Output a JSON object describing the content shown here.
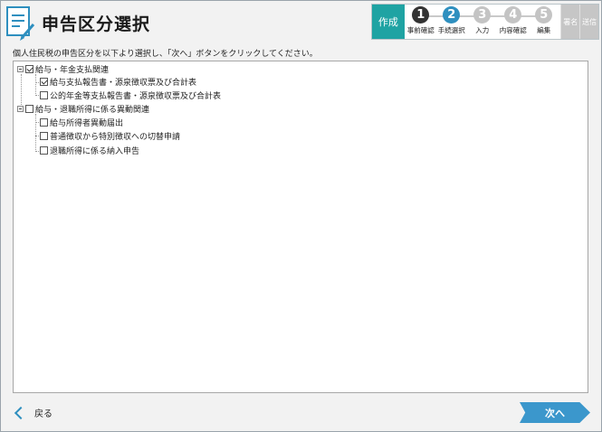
{
  "header": {
    "title": "申告区分選択",
    "icon": "document-pen-icon"
  },
  "stepbar": {
    "current_label": "作成",
    "steps": [
      {
        "num": "1",
        "label": "事前確認",
        "state": "done"
      },
      {
        "num": "2",
        "label": "手続選択",
        "state": "active"
      },
      {
        "num": "3",
        "label": "入力",
        "state": "todo"
      },
      {
        "num": "4",
        "label": "内容確認",
        "state": "todo"
      },
      {
        "num": "5",
        "label": "編集",
        "state": "todo"
      }
    ],
    "sign_label": "署名",
    "send_label": "送信"
  },
  "instruction": "個人住民税の申告区分を以下より選択し、「次へ」ボタンをクリックしてください。",
  "tree": {
    "groups": [
      {
        "label": "給与・年金支払関連",
        "checked": true,
        "children": [
          {
            "label": "給与支払報告書・源泉徴収票及び合計表",
            "checked": true
          },
          {
            "label": "公的年金等支払報告書・源泉徴収票及び合計表",
            "checked": false
          }
        ]
      },
      {
        "label": "給与・退職所得に係る異動関連",
        "checked": false,
        "children": [
          {
            "label": "給与所得者異動届出",
            "checked": false
          },
          {
            "label": "普通徴収から特別徴収への切替申請",
            "checked": false
          },
          {
            "label": "退職所得に係る納入申告",
            "checked": false
          }
        ]
      }
    ]
  },
  "footer": {
    "back_label": "戻る",
    "next_label": "次へ"
  },
  "colors": {
    "accent": "#1fa3a3",
    "active_step": "#2e8fbf",
    "next_button": "#3b97cc"
  }
}
